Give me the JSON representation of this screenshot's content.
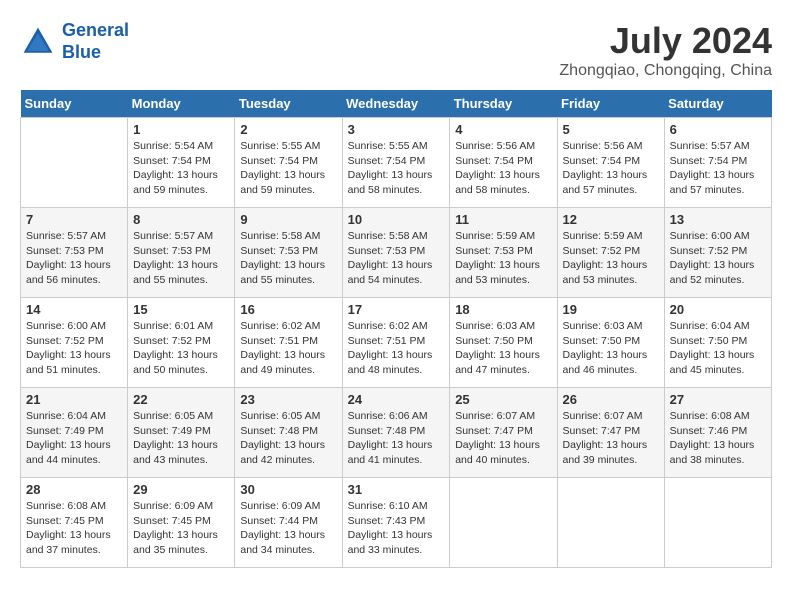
{
  "header": {
    "logo_line1": "General",
    "logo_line2": "Blue",
    "month_year": "July 2024",
    "location": "Zhongqiao, Chongqing, China"
  },
  "weekdays": [
    "Sunday",
    "Monday",
    "Tuesday",
    "Wednesday",
    "Thursday",
    "Friday",
    "Saturday"
  ],
  "weeks": [
    [
      {
        "day": "",
        "info": ""
      },
      {
        "day": "1",
        "info": "Sunrise: 5:54 AM\nSunset: 7:54 PM\nDaylight: 13 hours\nand 59 minutes."
      },
      {
        "day": "2",
        "info": "Sunrise: 5:55 AM\nSunset: 7:54 PM\nDaylight: 13 hours\nand 59 minutes."
      },
      {
        "day": "3",
        "info": "Sunrise: 5:55 AM\nSunset: 7:54 PM\nDaylight: 13 hours\nand 58 minutes."
      },
      {
        "day": "4",
        "info": "Sunrise: 5:56 AM\nSunset: 7:54 PM\nDaylight: 13 hours\nand 58 minutes."
      },
      {
        "day": "5",
        "info": "Sunrise: 5:56 AM\nSunset: 7:54 PM\nDaylight: 13 hours\nand 57 minutes."
      },
      {
        "day": "6",
        "info": "Sunrise: 5:57 AM\nSunset: 7:54 PM\nDaylight: 13 hours\nand 57 minutes."
      }
    ],
    [
      {
        "day": "7",
        "info": "Sunrise: 5:57 AM\nSunset: 7:53 PM\nDaylight: 13 hours\nand 56 minutes."
      },
      {
        "day": "8",
        "info": "Sunrise: 5:57 AM\nSunset: 7:53 PM\nDaylight: 13 hours\nand 55 minutes."
      },
      {
        "day": "9",
        "info": "Sunrise: 5:58 AM\nSunset: 7:53 PM\nDaylight: 13 hours\nand 55 minutes."
      },
      {
        "day": "10",
        "info": "Sunrise: 5:58 AM\nSunset: 7:53 PM\nDaylight: 13 hours\nand 54 minutes."
      },
      {
        "day": "11",
        "info": "Sunrise: 5:59 AM\nSunset: 7:53 PM\nDaylight: 13 hours\nand 53 minutes."
      },
      {
        "day": "12",
        "info": "Sunrise: 5:59 AM\nSunset: 7:52 PM\nDaylight: 13 hours\nand 53 minutes."
      },
      {
        "day": "13",
        "info": "Sunrise: 6:00 AM\nSunset: 7:52 PM\nDaylight: 13 hours\nand 52 minutes."
      }
    ],
    [
      {
        "day": "14",
        "info": "Sunrise: 6:00 AM\nSunset: 7:52 PM\nDaylight: 13 hours\nand 51 minutes."
      },
      {
        "day": "15",
        "info": "Sunrise: 6:01 AM\nSunset: 7:52 PM\nDaylight: 13 hours\nand 50 minutes."
      },
      {
        "day": "16",
        "info": "Sunrise: 6:02 AM\nSunset: 7:51 PM\nDaylight: 13 hours\nand 49 minutes."
      },
      {
        "day": "17",
        "info": "Sunrise: 6:02 AM\nSunset: 7:51 PM\nDaylight: 13 hours\nand 48 minutes."
      },
      {
        "day": "18",
        "info": "Sunrise: 6:03 AM\nSunset: 7:50 PM\nDaylight: 13 hours\nand 47 minutes."
      },
      {
        "day": "19",
        "info": "Sunrise: 6:03 AM\nSunset: 7:50 PM\nDaylight: 13 hours\nand 46 minutes."
      },
      {
        "day": "20",
        "info": "Sunrise: 6:04 AM\nSunset: 7:50 PM\nDaylight: 13 hours\nand 45 minutes."
      }
    ],
    [
      {
        "day": "21",
        "info": "Sunrise: 6:04 AM\nSunset: 7:49 PM\nDaylight: 13 hours\nand 44 minutes."
      },
      {
        "day": "22",
        "info": "Sunrise: 6:05 AM\nSunset: 7:49 PM\nDaylight: 13 hours\nand 43 minutes."
      },
      {
        "day": "23",
        "info": "Sunrise: 6:05 AM\nSunset: 7:48 PM\nDaylight: 13 hours\nand 42 minutes."
      },
      {
        "day": "24",
        "info": "Sunrise: 6:06 AM\nSunset: 7:48 PM\nDaylight: 13 hours\nand 41 minutes."
      },
      {
        "day": "25",
        "info": "Sunrise: 6:07 AM\nSunset: 7:47 PM\nDaylight: 13 hours\nand 40 minutes."
      },
      {
        "day": "26",
        "info": "Sunrise: 6:07 AM\nSunset: 7:47 PM\nDaylight: 13 hours\nand 39 minutes."
      },
      {
        "day": "27",
        "info": "Sunrise: 6:08 AM\nSunset: 7:46 PM\nDaylight: 13 hours\nand 38 minutes."
      }
    ],
    [
      {
        "day": "28",
        "info": "Sunrise: 6:08 AM\nSunset: 7:45 PM\nDaylight: 13 hours\nand 37 minutes."
      },
      {
        "day": "29",
        "info": "Sunrise: 6:09 AM\nSunset: 7:45 PM\nDaylight: 13 hours\nand 35 minutes."
      },
      {
        "day": "30",
        "info": "Sunrise: 6:09 AM\nSunset: 7:44 PM\nDaylight: 13 hours\nand 34 minutes."
      },
      {
        "day": "31",
        "info": "Sunrise: 6:10 AM\nSunset: 7:43 PM\nDaylight: 13 hours\nand 33 minutes."
      },
      {
        "day": "",
        "info": ""
      },
      {
        "day": "",
        "info": ""
      },
      {
        "day": "",
        "info": ""
      }
    ]
  ]
}
